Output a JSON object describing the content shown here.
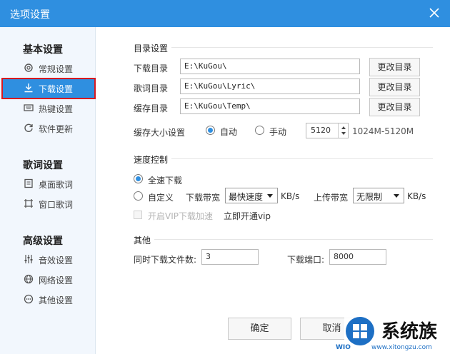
{
  "window": {
    "title": "选项设置"
  },
  "sidebar": {
    "groups": [
      {
        "title": "基本设置",
        "items": [
          {
            "label": "常规设置",
            "icon": "gear-icon"
          },
          {
            "label": "下载设置",
            "icon": "download-icon",
            "active": true
          },
          {
            "label": "热键设置",
            "icon": "keyboard-icon"
          },
          {
            "label": "软件更新",
            "icon": "refresh-icon"
          }
        ]
      },
      {
        "title": "歌词设置",
        "items": [
          {
            "label": "桌面歌词",
            "icon": "desktop-lyrics-icon"
          },
          {
            "label": "窗口歌词",
            "icon": "window-lyrics-icon"
          }
        ]
      },
      {
        "title": "高级设置",
        "items": [
          {
            "label": "音效设置",
            "icon": "equalizer-icon"
          },
          {
            "label": "网络设置",
            "icon": "globe-icon"
          },
          {
            "label": "其他设置",
            "icon": "more-icon"
          }
        ]
      }
    ]
  },
  "directory": {
    "title": "目录设置",
    "rows": [
      {
        "label": "下载目录",
        "value": "E:\\KuGou\\",
        "button": "更改目录"
      },
      {
        "label": "歌词目录",
        "value": "E:\\KuGou\\Lyric\\",
        "button": "更改目录"
      },
      {
        "label": "缓存目录",
        "value": "E:\\KuGou\\Temp\\",
        "button": "更改目录"
      }
    ],
    "cache_size_label": "缓存大小设置",
    "auto_label": "自动",
    "manual_label": "手动",
    "cache_value": "5120",
    "cache_range": "1024M-5120M"
  },
  "speed": {
    "title": "速度控制",
    "full_speed_label": "全速下载",
    "custom_label": "自定义",
    "download_bw_label": "下载带宽",
    "download_bw_value": "最快速度",
    "download_unit": "KB/s",
    "upload_bw_label": "上传带宽",
    "upload_bw_value": "无限制",
    "upload_unit": "KB/s",
    "vip_accel_label": "开启VIP下载加速",
    "vip_link": "立即开通vip"
  },
  "other": {
    "title": "其他",
    "simultaneous_label": "同时下载文件数:",
    "simultaneous_value": "3",
    "port_label": "下载端口:",
    "port_value": "8000"
  },
  "footer": {
    "ok_label": "确定",
    "cancel_label": "取消"
  },
  "watermark": {
    "brand": "系统族",
    "site_left": "WIO",
    "site_right": "www.xitongzu.com"
  }
}
